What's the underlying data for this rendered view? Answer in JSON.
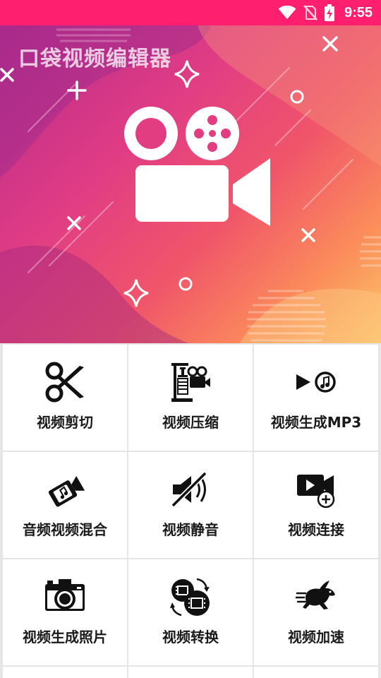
{
  "status_bar": {
    "time": "9:55",
    "icons": [
      "wifi-icon",
      "no-sim-icon",
      "battery-charging-icon"
    ],
    "background": "#ff1f6e"
  },
  "banner": {
    "title": "口袋视频编辑器",
    "icon": "video-camera-icon"
  },
  "tools": [
    {
      "label": "视频剪切",
      "icon": "scissors-icon"
    },
    {
      "label": "视频压缩",
      "icon": "compress-clamp-icon"
    },
    {
      "label": "视频生成MP3",
      "icon": "play-music-icon"
    },
    {
      "label": "音频视频混合",
      "icon": "video-music-tag-icon"
    },
    {
      "label": "视频静音",
      "icon": "mute-icon"
    },
    {
      "label": "视频连接",
      "icon": "video-add-icon"
    },
    {
      "label": "视频生成照片",
      "icon": "camera-icon"
    },
    {
      "label": "视频转换",
      "icon": "film-convert-icon"
    },
    {
      "label": "视频加速",
      "icon": "rabbit-speed-icon"
    }
  ]
}
